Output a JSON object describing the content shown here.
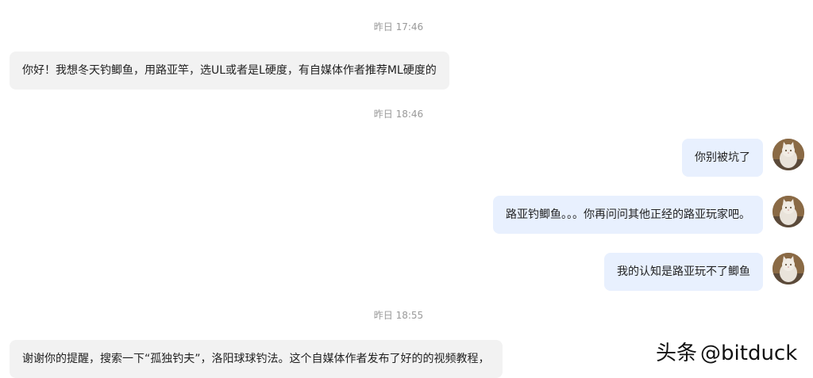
{
  "messages": [
    {
      "type": "timestamp",
      "text": "昨日 17:46"
    },
    {
      "type": "incoming",
      "text": "你好！我想冬天钓鲫鱼，用路亚竿，选UL或者是L硬度，有自媒体作者推荐ML硬度的"
    },
    {
      "type": "timestamp",
      "text": "昨日 18:46"
    },
    {
      "type": "outgoing",
      "text": "你别被坑了",
      "avatar": "cat-avatar"
    },
    {
      "type": "outgoing",
      "text": "路亚钓鲫鱼。。。你再问问其他正经的路亚玩家吧。",
      "avatar": "cat-avatar"
    },
    {
      "type": "outgoing",
      "text": "我的认知是路亚玩不了鲫鱼",
      "avatar": "cat-avatar"
    },
    {
      "type": "timestamp",
      "text": "昨日 18:55"
    },
    {
      "type": "incoming",
      "text": "谢谢你的提醒，搜索一下“孤独钓夫”，洛阳球球钓法。这个自媒体作者发布了好的的视频教程，"
    }
  ],
  "watermark": {
    "platform": "头条",
    "handle": "@bitduck"
  },
  "colors": {
    "incoming_bubble": "#f2f2f2",
    "outgoing_bubble": "#e8f0fe",
    "timestamp_text": "#999999"
  }
}
